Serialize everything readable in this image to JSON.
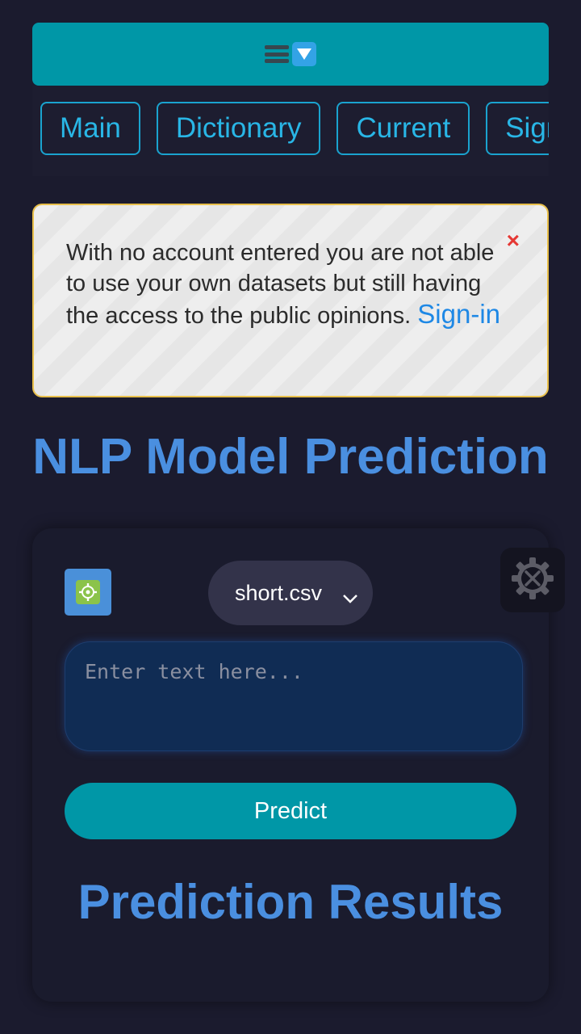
{
  "topbar": {
    "menu_icon": "hamburger-icon",
    "dropdown_icon": "arrow-down-icon"
  },
  "nav": {
    "tabs": [
      {
        "label": "Main"
      },
      {
        "label": "Dictionary"
      },
      {
        "label": "Current"
      },
      {
        "label": "Sign"
      }
    ]
  },
  "alert": {
    "message": "With no account entered you are not able to use your own datasets but still having the access to the public opinions.",
    "link_text": "Sign-in",
    "close_symbol": "×"
  },
  "page": {
    "title": "NLP Model Prediction"
  },
  "form": {
    "dataset_selected": "short.csv",
    "text_placeholder": "Enter text here...",
    "predict_label": "Predict",
    "results_title": "Prediction Results"
  },
  "colors": {
    "background": "#1b1b2e",
    "accent": "#0097a7",
    "title_blue": "#4a8fe0",
    "tab_border": "#1aa3cf",
    "alert_border": "#e8bf4a",
    "link": "#1e88e5",
    "close": "#e53935"
  }
}
